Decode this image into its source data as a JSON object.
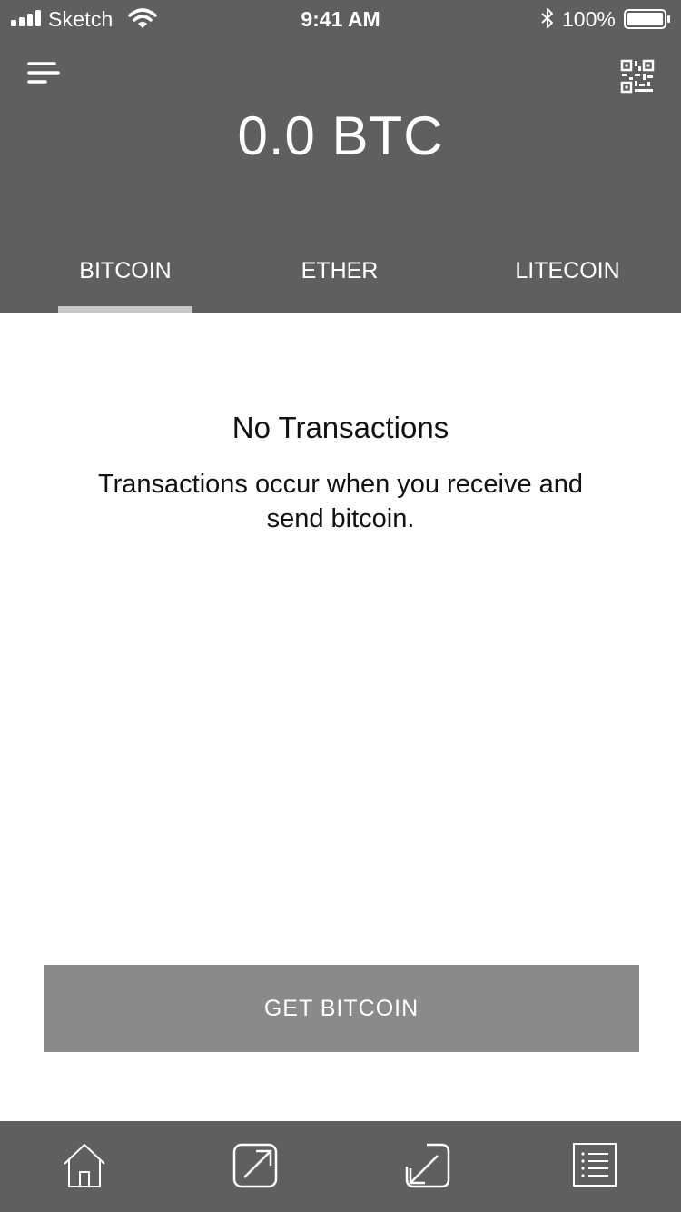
{
  "status_bar": {
    "carrier": "Sketch",
    "time": "9:41 AM",
    "battery_percent": "100%",
    "icons": [
      "signal-icon",
      "wifi-icon",
      "bluetooth-icon",
      "battery-icon"
    ]
  },
  "header": {
    "menu_icon": "menu-icon",
    "qr_icon": "qr-code-icon",
    "balance": "0.0 BTC",
    "background_color": "#5f5f5f"
  },
  "tabs": {
    "items": [
      {
        "label": "BITCOIN",
        "selected": true
      },
      {
        "label": "ETHER",
        "selected": false
      },
      {
        "label": "LITECOIN",
        "selected": false
      }
    ],
    "indicator_color": "#c8c8c8"
  },
  "empty_state": {
    "title": "No Transactions",
    "message": "Transactions occur when you receive and send bitcoin."
  },
  "cta": {
    "label": "GET BITCOIN",
    "color": "#8a8a8a"
  },
  "bottom_nav": {
    "items": [
      {
        "icon": "home-icon"
      },
      {
        "icon": "send-icon"
      },
      {
        "icon": "receive-icon"
      },
      {
        "icon": "transactions-list-icon"
      }
    ]
  }
}
